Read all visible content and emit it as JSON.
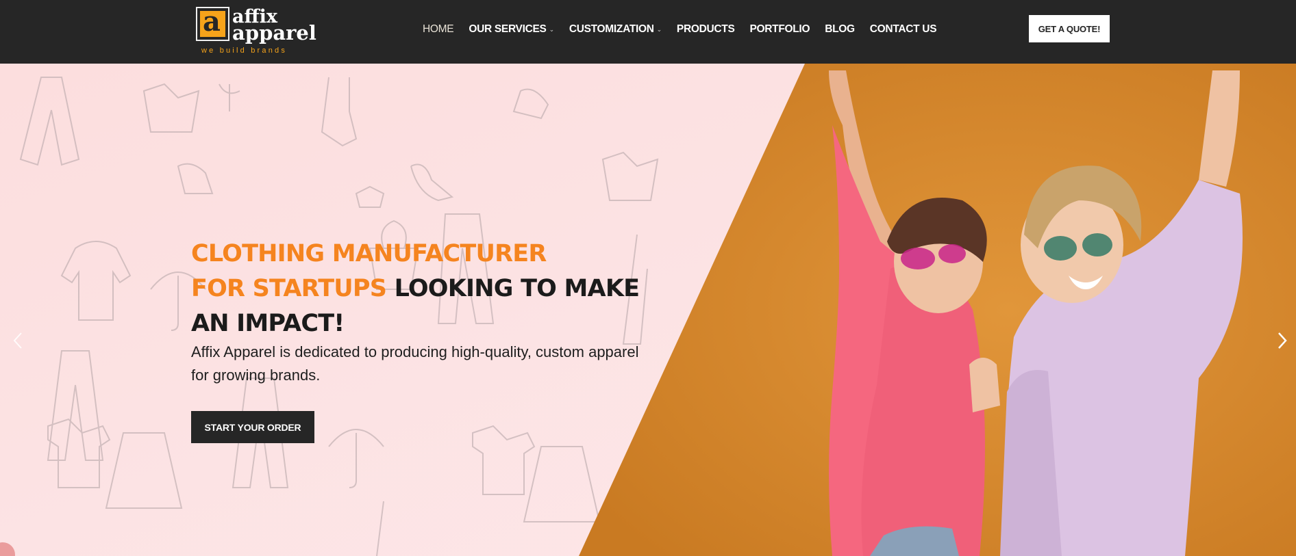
{
  "header": {
    "logo": {
      "mark_letter": "a",
      "word1": "affix",
      "word2": "apparel",
      "tagline": "we build brands"
    },
    "nav": [
      {
        "label": "HOME",
        "active": true,
        "dropdown": false
      },
      {
        "label": "OUR SERVICES",
        "active": false,
        "dropdown": true
      },
      {
        "label": "CUSTOMIZATION",
        "active": false,
        "dropdown": true
      },
      {
        "label": "PRODUCTS",
        "active": false,
        "dropdown": false
      },
      {
        "label": "PORTFOLIO",
        "active": false,
        "dropdown": false
      },
      {
        "label": "BLOG",
        "active": false,
        "dropdown": false
      },
      {
        "label": "CONTACT US",
        "active": false,
        "dropdown": false
      }
    ],
    "quote_button": "GET A QUOTE!"
  },
  "hero": {
    "headline_accent_1": "CLOTHING MANUFACTURER",
    "headline_accent_2": "FOR STARTUPS",
    "headline_rest_1": " LOOKING TO MAKE",
    "headline_rest_2": "AN IMPACT!",
    "subtext": "Affix Apparel is dedicated to producing high-quality, custom apparel for growing brands.",
    "cta": "START YOUR ORDER",
    "prev_icon": "chevron-left-icon",
    "next_icon": "chevron-right-icon"
  },
  "colors": {
    "header_bg": "#262626",
    "accent_orange": "#f5841f",
    "logo_orange": "#f6a31a",
    "hero_pink": "#fde3e3",
    "hero_orange": "#d9892e",
    "hoodie_pink": "#f5677f",
    "hoodie_lavender": "#dcc3e3"
  }
}
